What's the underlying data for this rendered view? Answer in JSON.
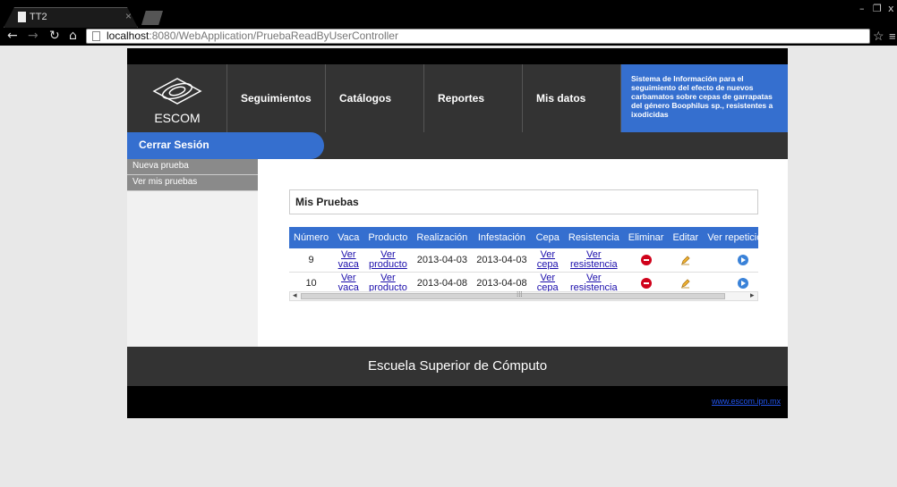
{
  "browser": {
    "tab_title": "TT2",
    "url_host": "localhost",
    "url_path": ":8080/WebApplication/PruebaReadByUserController"
  },
  "site": {
    "logo_text": "ESCOM",
    "nav": [
      {
        "label": "Seguimientos"
      },
      {
        "label": "Catálogos"
      },
      {
        "label": "Reportes"
      },
      {
        "label": "Mis datos"
      }
    ],
    "system_description": "Sistema de Información para el seguimiento del efecto de nuevos carbamatos sobre cepas de garrapatas del género Boophilus sp., resistentes a ixodicidas",
    "logout_label": "Cerrar Sesión",
    "sidebar": [
      {
        "label": "Nueva prueba"
      },
      {
        "label": "Ver mis pruebas"
      }
    ],
    "panel_title": "Mis Pruebas",
    "table": {
      "headers": [
        "Número",
        "Vaca",
        "Producto",
        "Realización",
        "Infestación",
        "Cepa",
        "Resistencia",
        "Eliminar",
        "Editar",
        "Ver repeticiones"
      ],
      "rows": [
        {
          "numero": "9",
          "vaca_l1": "Ver",
          "vaca_l2": "vaca",
          "producto_l1": "Ver",
          "producto_l2": "producto",
          "realizacion": "2013-04-03",
          "infestacion": "2013-04-03",
          "cepa_l1": "Ver",
          "cepa_l2": "cepa",
          "resistencia_l1": "Ver",
          "resistencia_l2": "resistencia"
        },
        {
          "numero": "10",
          "vaca_l1": "Ver",
          "vaca_l2": "vaca",
          "producto_l1": "Ver",
          "producto_l2": "producto",
          "realizacion": "2013-04-08",
          "infestacion": "2013-04-08",
          "cepa_l1": "Ver",
          "cepa_l2": "cepa",
          "resistencia_l1": "Ver",
          "resistencia_l2": "resistencia"
        }
      ]
    },
    "footer_text": "Escuela Superior de Cómputo",
    "bottom_link": "www.escom.ipn.mx"
  },
  "icons": {
    "delete": "delete-icon",
    "edit": "pencil-icon",
    "view": "arrow-right-circle-icon"
  },
  "colors": {
    "accent_blue": "#356fcf",
    "header_dark": "#333333",
    "delete_red": "#d0021b"
  }
}
